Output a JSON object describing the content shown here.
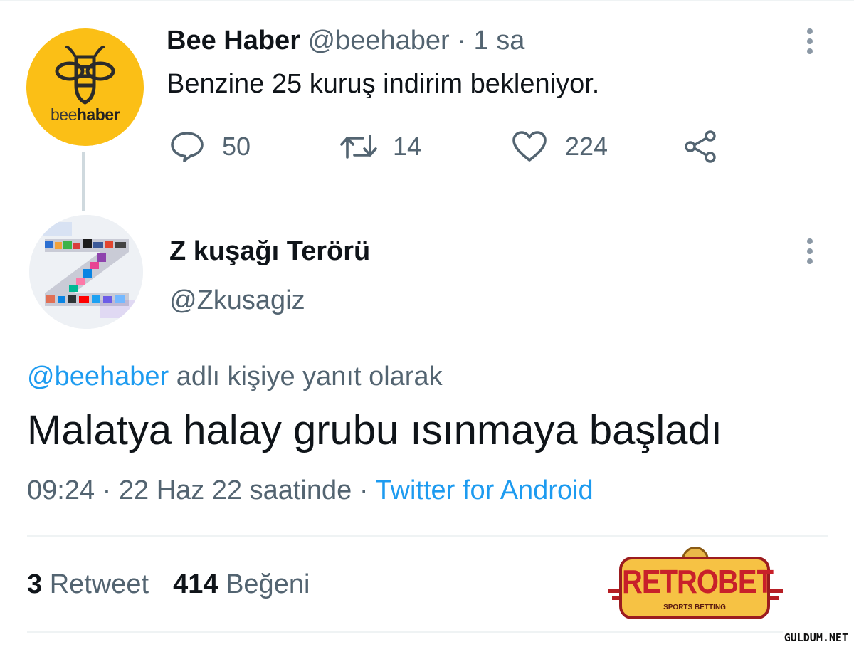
{
  "tweet1": {
    "author_name": "Bee Haber",
    "author_handle": "@beehaber",
    "separator": "·",
    "time": "1 sa",
    "avatar_logo_text_light": "bee",
    "avatar_logo_text_bold": "haber",
    "text": "Benzine 25 kuruş indirim bekleniyor.",
    "replies": "50",
    "retweets": "14",
    "likes": "224",
    "icons": {
      "reply": "reply-icon",
      "retweet": "retweet-icon",
      "like": "heart-icon",
      "share": "share-icon",
      "more": "more-icon"
    }
  },
  "tweet2": {
    "author_name": "Z kuşağı Terörü",
    "author_handle": "@Zkusagiz",
    "reply_mention": "@beehaber",
    "reply_suffix": "adlı kişiye yanıt olarak",
    "text": "Malatya halay grubu ısınmaya başladı",
    "timestamp": "09:24 · 22 Haz 22 saatinde",
    "separator": "·",
    "client": "Twitter for Android",
    "retweet_count": "3",
    "retweet_label": "Retweet",
    "like_count": "414",
    "like_label": "Beğeni"
  },
  "ad": {
    "brand": "RETROBET",
    "tagline": "SPORTS BETTING"
  },
  "watermark": "GULDUM.NET",
  "colors": {
    "accent": "#1d9bf0",
    "secondary_text": "#536471",
    "bee_yellow": "#fbbf16"
  }
}
